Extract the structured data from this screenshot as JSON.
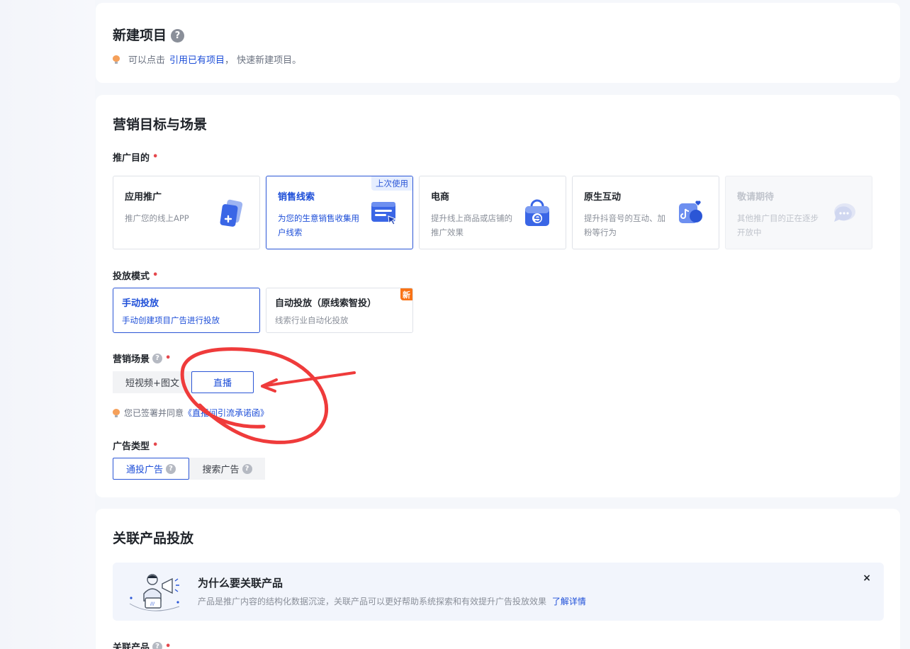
{
  "new_project": {
    "title": "新建项目",
    "help_glyph": "?",
    "hint_prefix": "可以点击",
    "hint_link": "引用已有项目",
    "hint_suffix": "， 快速新建项目。"
  },
  "marketing": {
    "title": "营销目标与场景",
    "goal_label": "推广目的",
    "required_mark": "•",
    "goals": [
      {
        "title": "应用推广",
        "desc": "推广您的线上APP",
        "icon": "app-cards-icon"
      },
      {
        "title": "销售线索",
        "desc": "为您的生意销售收集用户线索",
        "icon": "form-cursor-icon",
        "badge": "上次使用",
        "selected": true
      },
      {
        "title": "电商",
        "desc": "提升线上商品或店铺的推广效果",
        "icon": "shopping-bag-icon"
      },
      {
        "title": "原生互动",
        "desc": "提升抖音号的互动、加粉等行为",
        "icon": "douyin-heart-icon"
      },
      {
        "title": "敬请期待",
        "desc": "其他推广目的正在逐步开放中",
        "icon": "chat-bubble-icon",
        "disabled": true
      }
    ],
    "mode_label": "投放模式",
    "modes": [
      {
        "title": "手动投放",
        "desc": "手动创建项目广告进行投放",
        "selected": true
      },
      {
        "title": "自动投放（原线索智投）",
        "desc": "线索行业自动化投放",
        "badge": "新"
      }
    ],
    "scene_label": "营销场景",
    "scenes": [
      "短视频+图文",
      "直播"
    ],
    "selected_scene": "直播",
    "agree_prefix": "您已签署并同意",
    "agree_link": "《直播间引流承诺函》",
    "adtype_label": "广告类型",
    "ad_types": [
      "通投广告",
      "搜索广告"
    ],
    "selected_ad_type": "通投广告"
  },
  "product": {
    "title": "关联产品投放",
    "banner_title": "为什么要关联产品",
    "banner_desc": "产品是推广内容的结构化数据沉淀，关联产品可以更好帮助系统探索和有效提升广告投放效果",
    "banner_link": "了解详情",
    "close_glyph": "×",
    "field_label": "关联产品"
  },
  "annotation": {
    "color": "#ef3b3b"
  }
}
